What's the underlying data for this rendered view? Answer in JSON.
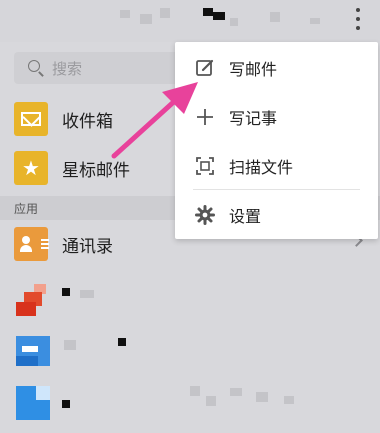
{
  "search": {
    "placeholder": "搜索",
    "icon": "search-icon"
  },
  "mail_items": [
    {
      "label": "收件箱",
      "icon": "inbox-icon"
    },
    {
      "label": "星标邮件",
      "icon": "star-icon"
    }
  ],
  "apps": {
    "section_label": "应用",
    "contacts_label": "通讯录"
  },
  "menu": {
    "items": [
      {
        "label": "写邮件",
        "icon": "compose-icon"
      },
      {
        "label": "写记事",
        "icon": "plus-icon"
      },
      {
        "label": "扫描文件",
        "icon": "scan-icon"
      },
      {
        "label": "设置",
        "icon": "gear-icon"
      }
    ]
  },
  "colors": {
    "annotation_arrow": "#e8429b",
    "inbox_accent": "#e8b42a",
    "contacts_accent": "#ea9a3c"
  }
}
